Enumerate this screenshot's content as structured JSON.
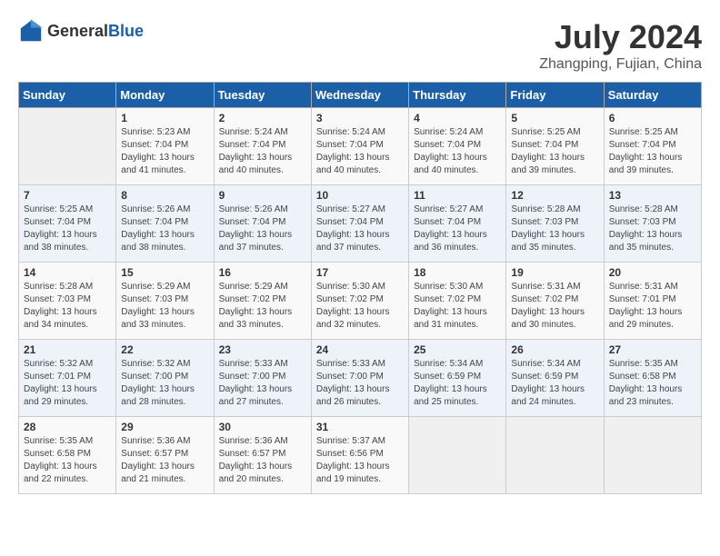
{
  "header": {
    "logo_general": "General",
    "logo_blue": "Blue",
    "month_year": "July 2024",
    "location": "Zhangping, Fujian, China"
  },
  "weekdays": [
    "Sunday",
    "Monday",
    "Tuesday",
    "Wednesday",
    "Thursday",
    "Friday",
    "Saturday"
  ],
  "weeks": [
    [
      {
        "day": "",
        "sunrise": "",
        "sunset": "",
        "daylight": ""
      },
      {
        "day": "1",
        "sunrise": "Sunrise: 5:23 AM",
        "sunset": "Sunset: 7:04 PM",
        "daylight": "Daylight: 13 hours and 41 minutes."
      },
      {
        "day": "2",
        "sunrise": "Sunrise: 5:24 AM",
        "sunset": "Sunset: 7:04 PM",
        "daylight": "Daylight: 13 hours and 40 minutes."
      },
      {
        "day": "3",
        "sunrise": "Sunrise: 5:24 AM",
        "sunset": "Sunset: 7:04 PM",
        "daylight": "Daylight: 13 hours and 40 minutes."
      },
      {
        "day": "4",
        "sunrise": "Sunrise: 5:24 AM",
        "sunset": "Sunset: 7:04 PM",
        "daylight": "Daylight: 13 hours and 40 minutes."
      },
      {
        "day": "5",
        "sunrise": "Sunrise: 5:25 AM",
        "sunset": "Sunset: 7:04 PM",
        "daylight": "Daylight: 13 hours and 39 minutes."
      },
      {
        "day": "6",
        "sunrise": "Sunrise: 5:25 AM",
        "sunset": "Sunset: 7:04 PM",
        "daylight": "Daylight: 13 hours and 39 minutes."
      }
    ],
    [
      {
        "day": "7",
        "sunrise": "Sunrise: 5:25 AM",
        "sunset": "Sunset: 7:04 PM",
        "daylight": "Daylight: 13 hours and 38 minutes."
      },
      {
        "day": "8",
        "sunrise": "Sunrise: 5:26 AM",
        "sunset": "Sunset: 7:04 PM",
        "daylight": "Daylight: 13 hours and 38 minutes."
      },
      {
        "day": "9",
        "sunrise": "Sunrise: 5:26 AM",
        "sunset": "Sunset: 7:04 PM",
        "daylight": "Daylight: 13 hours and 37 minutes."
      },
      {
        "day": "10",
        "sunrise": "Sunrise: 5:27 AM",
        "sunset": "Sunset: 7:04 PM",
        "daylight": "Daylight: 13 hours and 37 minutes."
      },
      {
        "day": "11",
        "sunrise": "Sunrise: 5:27 AM",
        "sunset": "Sunset: 7:04 PM",
        "daylight": "Daylight: 13 hours and 36 minutes."
      },
      {
        "day": "12",
        "sunrise": "Sunrise: 5:28 AM",
        "sunset": "Sunset: 7:03 PM",
        "daylight": "Daylight: 13 hours and 35 minutes."
      },
      {
        "day": "13",
        "sunrise": "Sunrise: 5:28 AM",
        "sunset": "Sunset: 7:03 PM",
        "daylight": "Daylight: 13 hours and 35 minutes."
      }
    ],
    [
      {
        "day": "14",
        "sunrise": "Sunrise: 5:28 AM",
        "sunset": "Sunset: 7:03 PM",
        "daylight": "Daylight: 13 hours and 34 minutes."
      },
      {
        "day": "15",
        "sunrise": "Sunrise: 5:29 AM",
        "sunset": "Sunset: 7:03 PM",
        "daylight": "Daylight: 13 hours and 33 minutes."
      },
      {
        "day": "16",
        "sunrise": "Sunrise: 5:29 AM",
        "sunset": "Sunset: 7:02 PM",
        "daylight": "Daylight: 13 hours and 33 minutes."
      },
      {
        "day": "17",
        "sunrise": "Sunrise: 5:30 AM",
        "sunset": "Sunset: 7:02 PM",
        "daylight": "Daylight: 13 hours and 32 minutes."
      },
      {
        "day": "18",
        "sunrise": "Sunrise: 5:30 AM",
        "sunset": "Sunset: 7:02 PM",
        "daylight": "Daylight: 13 hours and 31 minutes."
      },
      {
        "day": "19",
        "sunrise": "Sunrise: 5:31 AM",
        "sunset": "Sunset: 7:02 PM",
        "daylight": "Daylight: 13 hours and 30 minutes."
      },
      {
        "day": "20",
        "sunrise": "Sunrise: 5:31 AM",
        "sunset": "Sunset: 7:01 PM",
        "daylight": "Daylight: 13 hours and 29 minutes."
      }
    ],
    [
      {
        "day": "21",
        "sunrise": "Sunrise: 5:32 AM",
        "sunset": "Sunset: 7:01 PM",
        "daylight": "Daylight: 13 hours and 29 minutes."
      },
      {
        "day": "22",
        "sunrise": "Sunrise: 5:32 AM",
        "sunset": "Sunset: 7:00 PM",
        "daylight": "Daylight: 13 hours and 28 minutes."
      },
      {
        "day": "23",
        "sunrise": "Sunrise: 5:33 AM",
        "sunset": "Sunset: 7:00 PM",
        "daylight": "Daylight: 13 hours and 27 minutes."
      },
      {
        "day": "24",
        "sunrise": "Sunrise: 5:33 AM",
        "sunset": "Sunset: 7:00 PM",
        "daylight": "Daylight: 13 hours and 26 minutes."
      },
      {
        "day": "25",
        "sunrise": "Sunrise: 5:34 AM",
        "sunset": "Sunset: 6:59 PM",
        "daylight": "Daylight: 13 hours and 25 minutes."
      },
      {
        "day": "26",
        "sunrise": "Sunrise: 5:34 AM",
        "sunset": "Sunset: 6:59 PM",
        "daylight": "Daylight: 13 hours and 24 minutes."
      },
      {
        "day": "27",
        "sunrise": "Sunrise: 5:35 AM",
        "sunset": "Sunset: 6:58 PM",
        "daylight": "Daylight: 13 hours and 23 minutes."
      }
    ],
    [
      {
        "day": "28",
        "sunrise": "Sunrise: 5:35 AM",
        "sunset": "Sunset: 6:58 PM",
        "daylight": "Daylight: 13 hours and 22 minutes."
      },
      {
        "day": "29",
        "sunrise": "Sunrise: 5:36 AM",
        "sunset": "Sunset: 6:57 PM",
        "daylight": "Daylight: 13 hours and 21 minutes."
      },
      {
        "day": "30",
        "sunrise": "Sunrise: 5:36 AM",
        "sunset": "Sunset: 6:57 PM",
        "daylight": "Daylight: 13 hours and 20 minutes."
      },
      {
        "day": "31",
        "sunrise": "Sunrise: 5:37 AM",
        "sunset": "Sunset: 6:56 PM",
        "daylight": "Daylight: 13 hours and 19 minutes."
      },
      {
        "day": "",
        "sunrise": "",
        "sunset": "",
        "daylight": ""
      },
      {
        "day": "",
        "sunrise": "",
        "sunset": "",
        "daylight": ""
      },
      {
        "day": "",
        "sunrise": "",
        "sunset": "",
        "daylight": ""
      }
    ]
  ]
}
